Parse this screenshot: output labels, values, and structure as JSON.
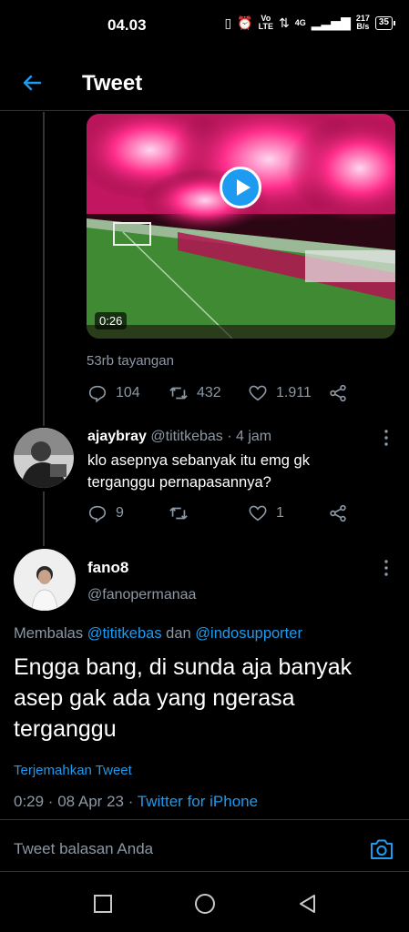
{
  "status": {
    "time": "04.03",
    "volte": "Vo\nLTE",
    "net": "4G",
    "speed": "217\nB/s",
    "battery": "35"
  },
  "header": {
    "title": "Tweet"
  },
  "video": {
    "duration": "0:26",
    "views": "53rb tayangan"
  },
  "tweet_actions": {
    "replies": "104",
    "retweets": "432",
    "likes": "1.911"
  },
  "reply1": {
    "name": "ajaybray",
    "handle": "@tititkebas",
    "time": "· 4 jam",
    "text": "klo asepnya sebanyak itu emg gk terganggu pernapasannya?",
    "replies": "9",
    "retweets": "",
    "likes": "1"
  },
  "main": {
    "name": "fano8",
    "handle": "@fanopermanaa",
    "replying_prefix": "Membalas ",
    "replying_user1": "@tititkebas",
    "replying_mid": " dan ",
    "replying_user2": "@indosupporter",
    "text": "Engga bang, di sunda aja banyak asep gak ada yang ngerasa terganggu",
    "translate": "Terjemahkan Tweet",
    "meta_time": "0:29 · 08 Apr 23 · ",
    "meta_source": "Twitter for iPhone"
  },
  "composer": {
    "placeholder": "Tweet balasan Anda"
  },
  "colors": {
    "accent": "#1d9bf0",
    "muted": "#8b98a5",
    "background": "#000000"
  }
}
